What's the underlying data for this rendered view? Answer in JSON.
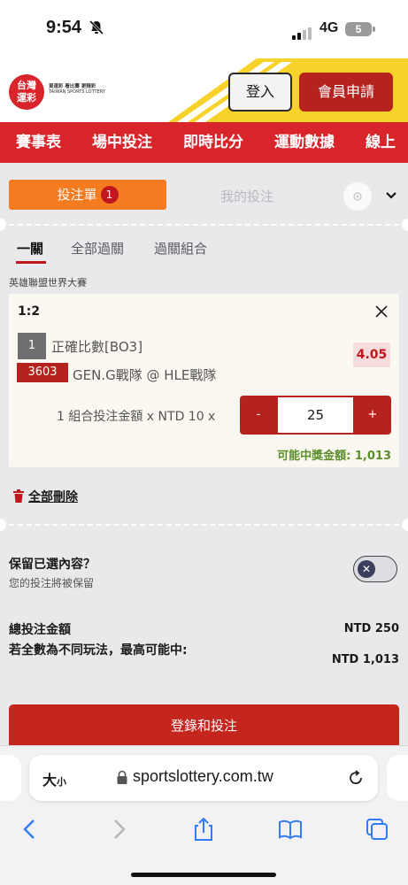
{
  "status": {
    "time": "9:54",
    "network": "4G",
    "battery": "5"
  },
  "header": {
    "logo": {
      "line1": "台灣",
      "line2": "運彩",
      "tag_cn": "買運彩 看比賽 更精彩",
      "tag_en": "TAIWAN SPORTS LOTTERY"
    },
    "login_label": "登入",
    "register_label": "會員申請"
  },
  "nav": {
    "items": [
      "賽事表",
      "場中投注",
      "即時比分",
      "運動數據",
      "線上"
    ]
  },
  "slip": {
    "tab_bet": "投注單",
    "tab_bet_count": "1",
    "tab_mine": "我的投注",
    "subtabs": [
      "一關",
      "全部過關",
      "過關組合"
    ],
    "league": "英雄聯盟世界大賽",
    "selection": {
      "score": "1:2",
      "index": "1",
      "market": "正確比數[BO3]",
      "odds": "4.05",
      "event_id": "3603",
      "match": "GEN.G戰隊 @ HLE戰隊",
      "stake_label": "1 組合投注金額 x NTD 10 x",
      "minus": "-",
      "stake_value": "25",
      "plus": "+",
      "potential_win": "可能中獎金額: 1,013"
    },
    "delete_all": "全部刪除",
    "keep_question": "保留已選內容？",
    "keep_sub": "您的投注將被保留",
    "total_label": "總投注金額",
    "total_value": "NTD 250",
    "max_label": "若全數為不同玩法，最高可能中:",
    "max_value": "NTD 1,013",
    "submit_label": "登錄和投注"
  },
  "browser": {
    "aa_big": "大",
    "aa_small": "小",
    "url": "sportslottery.com.tw"
  },
  "colors": {
    "brand_red": "#d8252c",
    "orange": "#f47b20",
    "win_green": "#5a8f2a",
    "yellow": "#f7d22b"
  }
}
